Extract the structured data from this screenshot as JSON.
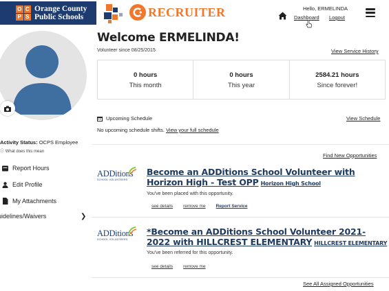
{
  "header": {
    "org_line1": "Orange County",
    "org_line2": "Public Schools",
    "ocps_letters": [
      "O",
      "C",
      "P",
      "S"
    ],
    "app_name": "RECRUITER",
    "greeting": "Hello, ERMELINDA",
    "nav": {
      "dashboard": "Dashboard",
      "logout": "Logout"
    },
    "icons": [
      "home-icon",
      "hamburger-menu-icon"
    ]
  },
  "sidebar": {
    "activity_label": "Activity Status:",
    "activity_value": "OCPS Employee",
    "what_means": "What does this mean",
    "items": [
      {
        "label": "Report Hours",
        "icon": "report-hours-icon"
      },
      {
        "label": "Edit Profile",
        "icon": "person-icon"
      },
      {
        "label": "My Attachments",
        "icon": "attachments-icon"
      },
      {
        "label": "Guidelines/Waivers",
        "icon": "chevron-right-icon"
      }
    ]
  },
  "main": {
    "welcome": "Welcome ERMELINDA!",
    "volunteer_since": "Volunteer since 08/25/2015",
    "view_history": "View Service History",
    "stats": [
      {
        "value": "0 hours",
        "label": "This month"
      },
      {
        "value": "0 hours",
        "label": "This year"
      },
      {
        "value": "2584.21 hours",
        "label": "Since forever!"
      }
    ],
    "schedule": {
      "title": "Upcoming Schedule",
      "view_link": "View Schedule",
      "empty_text": "No upcoming schedule shifts.",
      "full_link": "View your full schedule"
    },
    "find_new": "Find New Opportunities",
    "opportunities": [
      {
        "title": "Become an ADDitions School Volunteer with Horizon High - Test OPP",
        "school": "Horizon High School",
        "status": "You've been placed with this opportunity.",
        "actions": [
          "see details",
          "remove me",
          "Report Service"
        ]
      },
      {
        "title": "*Become an ADDitions School Volunteer 2021-2022 with HILLCREST ELEMENTARY",
        "school": "HILLCREST ELEMENTARY",
        "status": "You've been referred for this opportunity.",
        "actions": [
          "see details",
          "remove me"
        ]
      }
    ],
    "logo_text": "ADDitions",
    "logo_sub": "SCHOOL VOLUNTEERS",
    "see_all": "See All Assigned Opportunities"
  },
  "colors": {
    "navy": "#1d3b6e",
    "orange": "#f0782d",
    "title": "#1e3a5f",
    "avatar": "#3f6ea1"
  }
}
